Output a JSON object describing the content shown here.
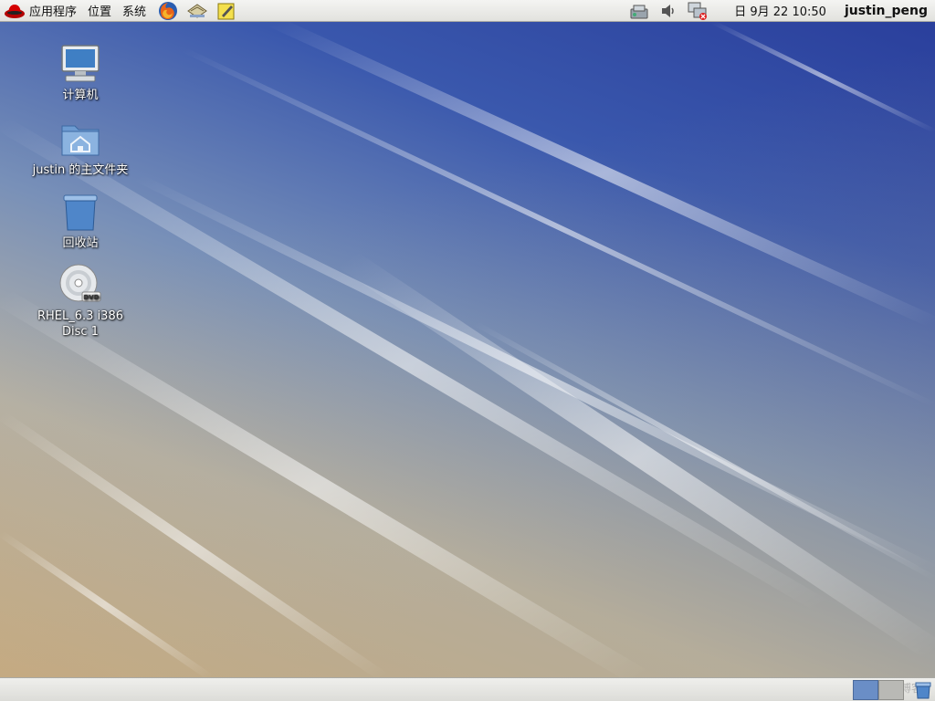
{
  "top_panel": {
    "menus": [
      "应用程序",
      "位置",
      "系统"
    ],
    "launchers": [
      "firefox-icon",
      "email-icon",
      "notes-icon"
    ],
    "tray": [
      "network-icon",
      "volume-icon",
      "network-disconnected-icon"
    ],
    "clock": "日 9月 22 10:50",
    "user": "justin_peng"
  },
  "desktop": {
    "icons": [
      {
        "label": "计算机",
        "icon": "computer-icon"
      },
      {
        "label": "justin 的主文件夹",
        "icon": "home-folder-icon"
      },
      {
        "label": "回收站",
        "icon": "trash-icon"
      },
      {
        "label": "RHEL_6.3 i386 Disc 1",
        "icon": "dvd-icon"
      }
    ]
  },
  "bottom_panel": {
    "watermark": "@51CTO博客"
  },
  "colors": {
    "panel": "#e8e8e5",
    "desktop_top": "#2a3f9c",
    "desktop_bottom": "#c9ad84"
  }
}
